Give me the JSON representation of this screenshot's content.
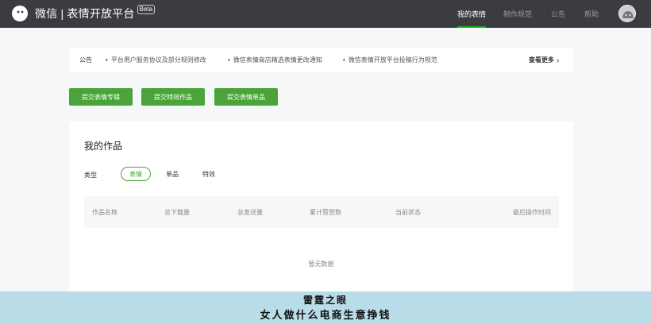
{
  "header": {
    "brand": "微信 | 表情开放平台",
    "beta": "Beta",
    "nav": [
      {
        "label": "我的表情",
        "active": true
      },
      {
        "label": "制作规范",
        "active": false
      },
      {
        "label": "公告",
        "active": false
      },
      {
        "label": "帮助",
        "active": false
      }
    ]
  },
  "notice": {
    "label": "公告",
    "items": [
      "平台用户服务协议及部分规则修改",
      "微信表情商店精选表情更改通知",
      "微信表情开放平台投稿行为规范"
    ],
    "more": "查看更多"
  },
  "actions": {
    "submit_album": "提交表情专辑",
    "submit_effect": "提交特效作品",
    "submit_single": "提交表情单品"
  },
  "works": {
    "title": "我的作品",
    "filter_label": "类型",
    "filters": [
      {
        "label": "表情",
        "active": true
      },
      {
        "label": "单品",
        "active": false
      },
      {
        "label": "特效",
        "active": false
      }
    ],
    "columns": [
      "作品名称",
      "总下载量",
      "总发送量",
      "累计赞赏数",
      "当前状态",
      "最后操作时间"
    ],
    "empty_text": "暂无数据"
  },
  "caption": {
    "line1": "雷霆之眼",
    "line2": "女人做什么电商生意挣钱"
  },
  "colors": {
    "header_bg": "#3b3c40",
    "accent_green": "#4aa43a",
    "page_bg": "#f6f7f9",
    "caption_bg": "#b8dde8"
  }
}
